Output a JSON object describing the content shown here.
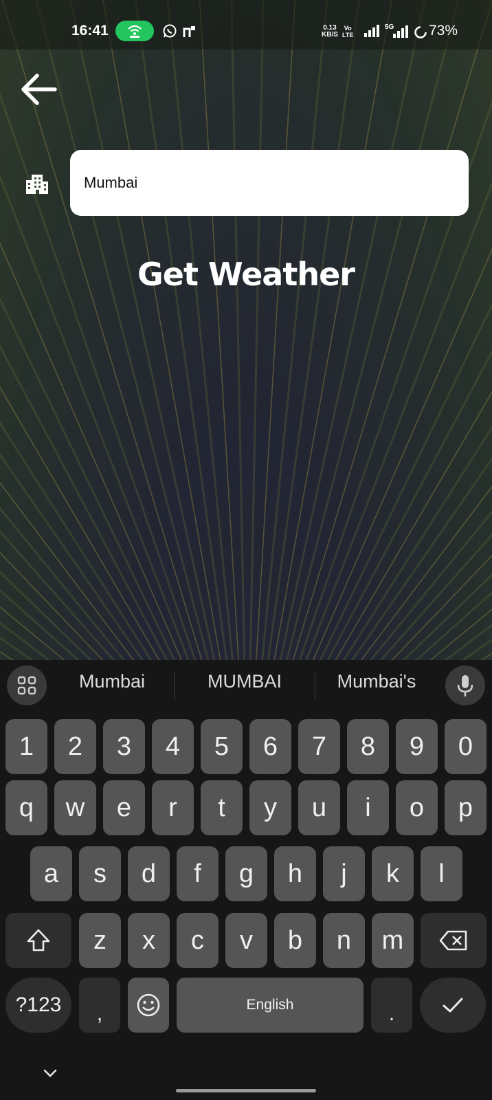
{
  "status_bar": {
    "time": "16:41",
    "net_speed_value": "0.13",
    "net_speed_unit": "KB/S",
    "volte_top": "Vo",
    "volte_bottom": "LTE",
    "network_type": "5G",
    "battery_percent": "73%"
  },
  "search": {
    "city_value": "Mumbai"
  },
  "main": {
    "title": "Get Weather"
  },
  "keyboard": {
    "suggestions": [
      "Mumbai",
      "MUMBAI",
      "Mumbai's"
    ],
    "row_numbers": [
      "1",
      "2",
      "3",
      "4",
      "5",
      "6",
      "7",
      "8",
      "9",
      "0"
    ],
    "row_top": [
      "q",
      "w",
      "e",
      "r",
      "t",
      "y",
      "u",
      "i",
      "o",
      "p"
    ],
    "row_middle": [
      "a",
      "s",
      "d",
      "f",
      "g",
      "h",
      "j",
      "k",
      "l"
    ],
    "row_bottom": [
      "z",
      "x",
      "c",
      "v",
      "b",
      "n",
      "m"
    ],
    "symbols_label": "?123",
    "comma_label": ",",
    "space_label": "English",
    "period_label": "."
  },
  "colors": {
    "hotspot": "#22c55e",
    "keyboard_bg": "#161616",
    "key_bg": "#555555",
    "key_dark_bg": "#2e2e2e"
  },
  "icons": {
    "back": "arrow-left-icon",
    "city": "city-buildings-icon",
    "grid": "apps-grid-icon",
    "mic": "microphone-icon",
    "shift": "shift-icon",
    "backspace": "backspace-icon",
    "emoji": "emoji-icon",
    "enter": "check-icon",
    "collapse": "chevron-down-icon"
  }
}
